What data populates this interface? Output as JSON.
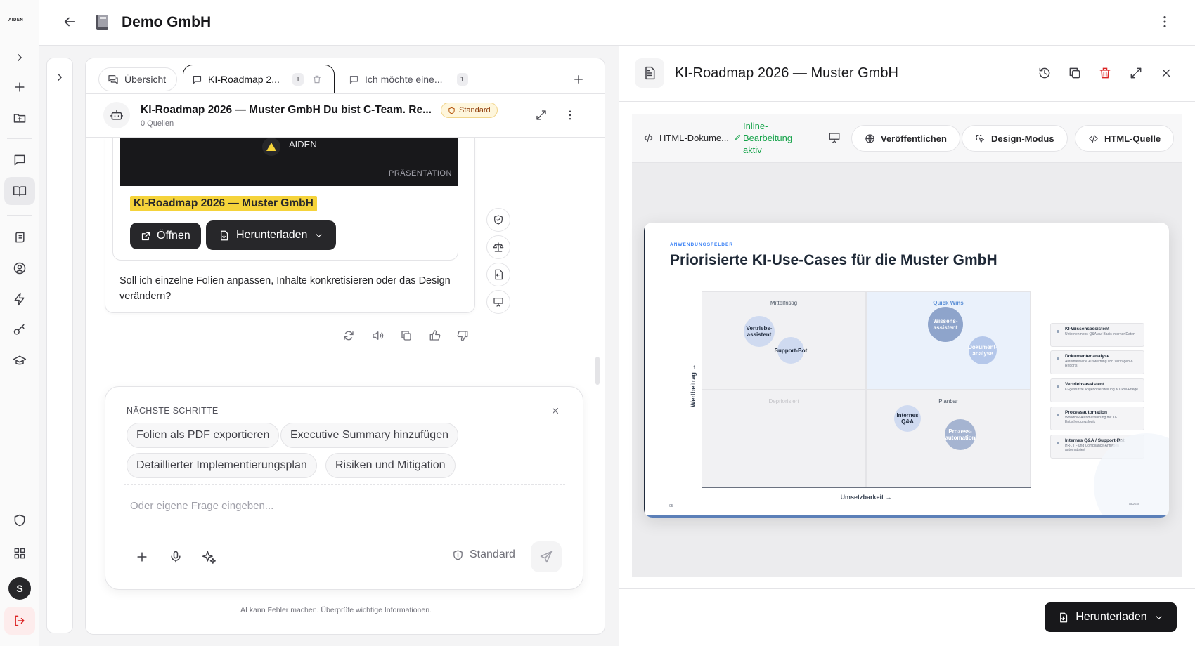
{
  "rail": {
    "logo": "AIDEN",
    "avatar_letter": "S"
  },
  "header": {
    "title": "Demo GmbH"
  },
  "tabs": [
    {
      "label": "Übersicht"
    },
    {
      "label": "KI-Roadmap 2...",
      "count": "1"
    },
    {
      "label": "Ich möchte eine...",
      "count": "1"
    }
  ],
  "chat": {
    "title": "KI-Roadmap 2026 — Muster GmbH Du bist C-Team. Re...",
    "sources": "0 Quellen",
    "mode_badge": "Standard",
    "preview_brand": "AIDEN",
    "preview_type": "PRÄSENTATION",
    "doc_title": "KI-Roadmap 2026 — Muster GmbH",
    "open_label": "Öffnen",
    "download_label": "Herunterladen",
    "message_line1": "Soll ich einzelne Folien anpassen, Inhalte konkretisieren oder das Design",
    "message_line2": "verändern?"
  },
  "next_steps": {
    "heading": "NÄCHSTE SCHRITTE",
    "suggestions": [
      "Folien als PDF exportieren",
      "Executive Summary hinzufügen",
      "Detaillierter Implementierungsplan",
      "Risiken und Mitigation"
    ],
    "input_placeholder": "Oder eigene Frage eingeben...",
    "mode_label": "Standard"
  },
  "disclaimer": "AI kann Fehler machen. Überprüfe wichtige Informationen.",
  "doc_panel": {
    "title": "KI-Roadmap 2026 — Muster GmbH",
    "file_label": "HTML-Dokume...",
    "inline_edit": [
      "Inline-",
      "Bearbeitung",
      "aktiv"
    ],
    "publish": "Veröffentlichen",
    "design_mode": "Design-Modus",
    "html_source": "HTML-Quelle",
    "download": "Herunterladen"
  },
  "slide": {
    "eyebrow": "ANWENDUNGSFELDER",
    "title": "Priorisierte KI-Use-Cases für die Muster GmbH",
    "quadrants": [
      "Mittelfristig",
      "Quick Wins",
      "Depriorisiert",
      "Planbar"
    ],
    "y_axis": "Wertbeitrag →",
    "x_axis": "Umsetzbarkeit →",
    "page_number": "05",
    "footer_brand": "AIDEN",
    "bubbles": [
      {
        "label": "Vertriebs-\nassistent"
      },
      {
        "label": "Support-Bot"
      },
      {
        "label": "Wissens-\nassistent"
      },
      {
        "label": "Dokument-\nanalyse"
      },
      {
        "label": "Internes\nQ&A"
      },
      {
        "label": "Prozess-\nautomation"
      }
    ],
    "cards": [
      {
        "title": "KI-Wissensassistent",
        "desc": "Unternehmens-Q&A auf Basis interner Daten"
      },
      {
        "title": "Dokumentenanalyse",
        "desc": "Automatisierte Auswertung von Verträgen & Reports"
      },
      {
        "title": "Vertriebsassistent",
        "desc": "KI-gestützte Angebotserstellung & CRM-Pflege"
      },
      {
        "title": "Prozessautomation",
        "desc": "Workflow-Automatisierung mit KI-Entscheidungslogik"
      },
      {
        "title": "Internes Q&A / Support-Bot",
        "desc": "HR-, IT- und Compliance-Anfragen automatisiert"
      }
    ]
  },
  "colors": {
    "accent_yellow": "#f5d33a",
    "dark_button": "#27272a",
    "success_green": "#16a34a",
    "danger_red": "#dc2626",
    "quickwin_bg": "#eaf1fb"
  }
}
